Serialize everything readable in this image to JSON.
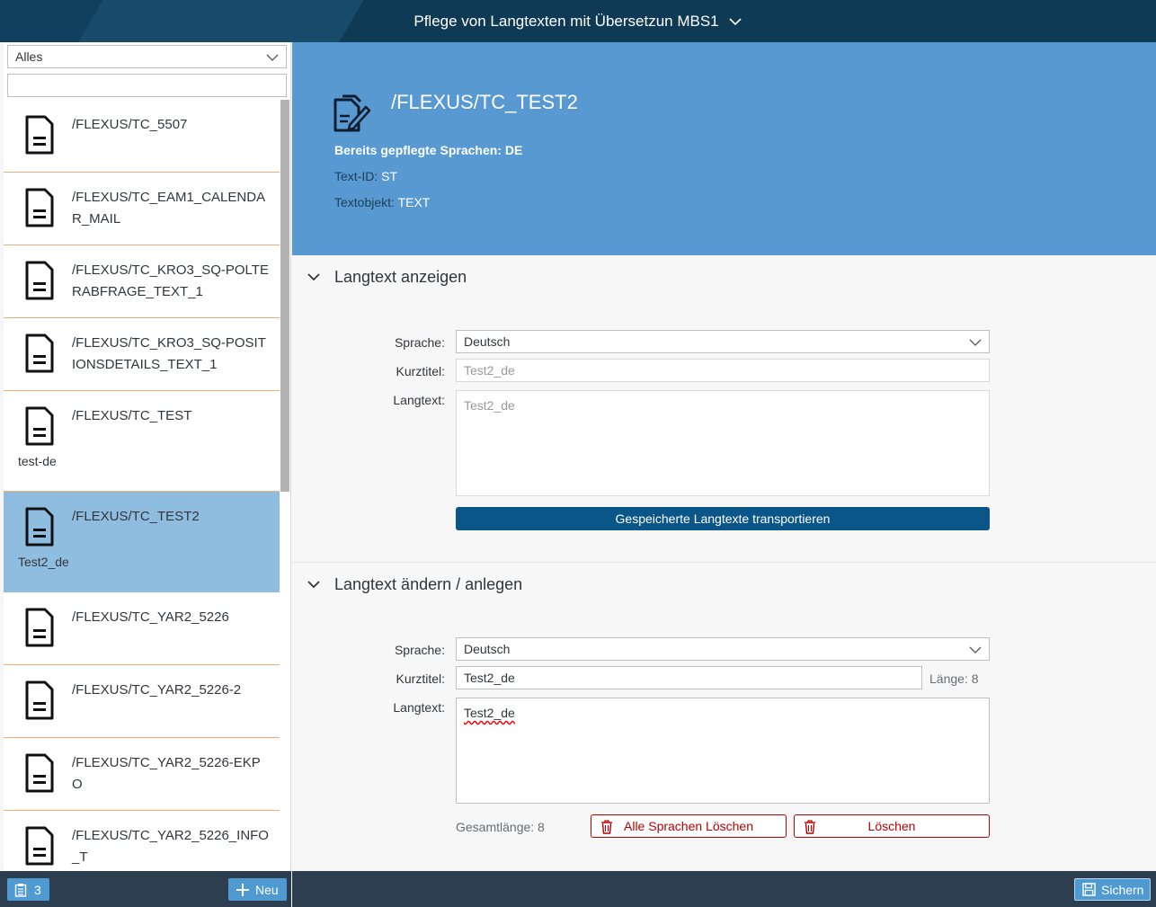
{
  "shell": {
    "title": "Pflege von Langtexten mit Übersetzun MBS1"
  },
  "master": {
    "filter_value": "Alles",
    "search_value": "",
    "items": [
      {
        "title": "/FLEXUS/TC_5507",
        "sub": ""
      },
      {
        "title": "/FLEXUS/TC_EAM1_CALENDAR_MAIL",
        "sub": ""
      },
      {
        "title": "/FLEXUS/TC_KRO3_SQ-POLTERABFRAGE_TEXT_1",
        "sub": ""
      },
      {
        "title": "/FLEXUS/TC_KRO3_SQ-POSITIONSDETAILS_TEXT_1",
        "sub": ""
      },
      {
        "title": "/FLEXUS/TC_TEST",
        "sub": "test-de"
      },
      {
        "title": "/FLEXUS/TC_TEST2",
        "sub": "Test2_de"
      },
      {
        "title": "/FLEXUS/TC_YAR2_5226",
        "sub": ""
      },
      {
        "title": "/FLEXUS/TC_YAR2_5226-2",
        "sub": ""
      },
      {
        "title": "/FLEXUS/TC_YAR2_5226-EKPO",
        "sub": ""
      },
      {
        "title": "/FLEXUS/TC_YAR2_5226_INFO_T",
        "sub": ""
      }
    ],
    "footer": {
      "count": "3",
      "new_label": "Neu"
    }
  },
  "detail": {
    "header": {
      "title": "/FLEXUS/TC_TEST2",
      "languages": "Bereits gepflegte Sprachen: DE",
      "text_id_label": "Text-ID:",
      "text_id_value": "ST",
      "text_object_label": "Textobjekt:",
      "text_object_value": "TEXT"
    },
    "display_section": {
      "title": "Langtext anzeigen",
      "language_label": "Sprache:",
      "language_value": "Deutsch",
      "short_title_label": "Kurztitel:",
      "short_title_value": "Test2_de",
      "long_text_label": "Langtext:",
      "long_text_value": "Test2_de",
      "transport_button": "Gespeicherte Langtexte transportieren"
    },
    "edit_section": {
      "title": "Langtext ändern / anlegen",
      "language_label": "Sprache:",
      "language_value": "Deutsch",
      "short_title_label": "Kurztitel:",
      "short_title_value": "Test2_de",
      "length_label": "Länge: 8",
      "long_text_label": "Langtext:",
      "long_text_value": "Test2_de",
      "total_length": "Gesamtlänge: 8",
      "delete_all_button": "Alle Sprachen Löschen",
      "delete_button": "Löschen"
    },
    "footer": {
      "save_label": "Sichern"
    }
  },
  "colors": {
    "shell_bg": "#0f3a55",
    "header_bg": "#5899d1",
    "selected_item": "#8fbde0",
    "item_border": "#f0ab78",
    "primary_button": "#0a5688",
    "footer_bg": "#2c3e50",
    "footer_button": "#4e9ad1",
    "delete_red": "#bb0000"
  },
  "icons": {
    "list_item": "document-icon",
    "header": "edit-document-icon",
    "chevron": "chevron-down-icon",
    "delete": "trash-icon",
    "new": "plus-icon",
    "count": "clipboard-icon",
    "save": "save-icon"
  }
}
